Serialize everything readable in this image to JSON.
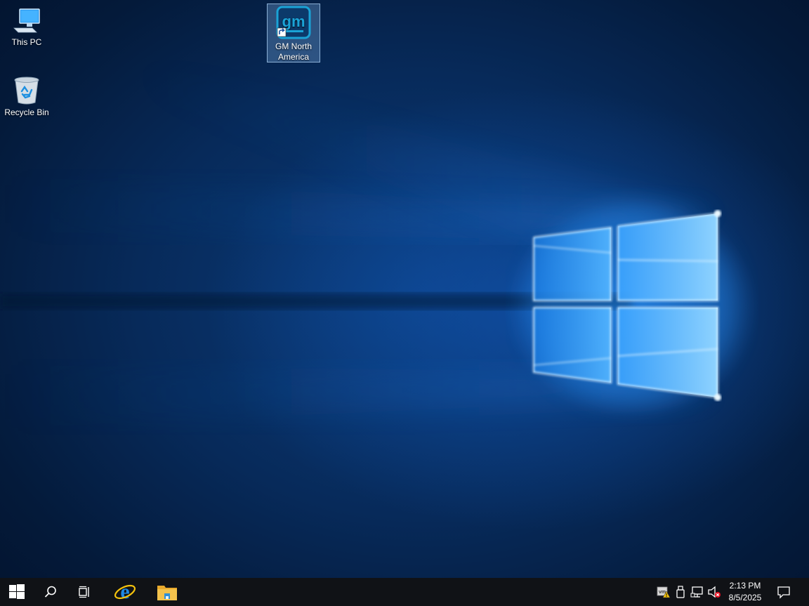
{
  "desktop": {
    "icons": [
      {
        "label": "This PC",
        "icon": "computer-icon"
      },
      {
        "label": "Recycle Bin",
        "icon": "recycle-bin-icon"
      },
      {
        "label": "GM North America",
        "icon": "gm-logo-icon",
        "shortcut": true,
        "selected": true
      }
    ],
    "wallpaper": "windows-10-light-logo"
  },
  "taskbar": {
    "start": {
      "icon": "windows-start-icon"
    },
    "search": {
      "icon": "search-icon"
    },
    "task_view": {
      "icon": "task-view-icon"
    },
    "pinned": [
      {
        "name": "Internet Explorer",
        "icon": "internet-explorer-icon"
      },
      {
        "name": "File Explorer",
        "icon": "file-explorer-icon"
      }
    ],
    "tray": [
      {
        "icon": "vmware-tools-warning-icon"
      },
      {
        "icon": "usb-device-icon"
      },
      {
        "icon": "network-icon"
      },
      {
        "icon": "volume-muted-icon"
      }
    ],
    "clock": {
      "time": "2:13 PM",
      "date": "8/5/2025"
    },
    "notifications": {
      "icon": "action-center-icon"
    }
  },
  "colors": {
    "taskbar_bg": "#101216",
    "accent_glow": "#3aa0ff",
    "ie_blue": "#1e88e5",
    "ie_ring": "#f4c20d",
    "folder_yellow": "#f3c24c",
    "gm_tile": "#1aa3d6"
  }
}
